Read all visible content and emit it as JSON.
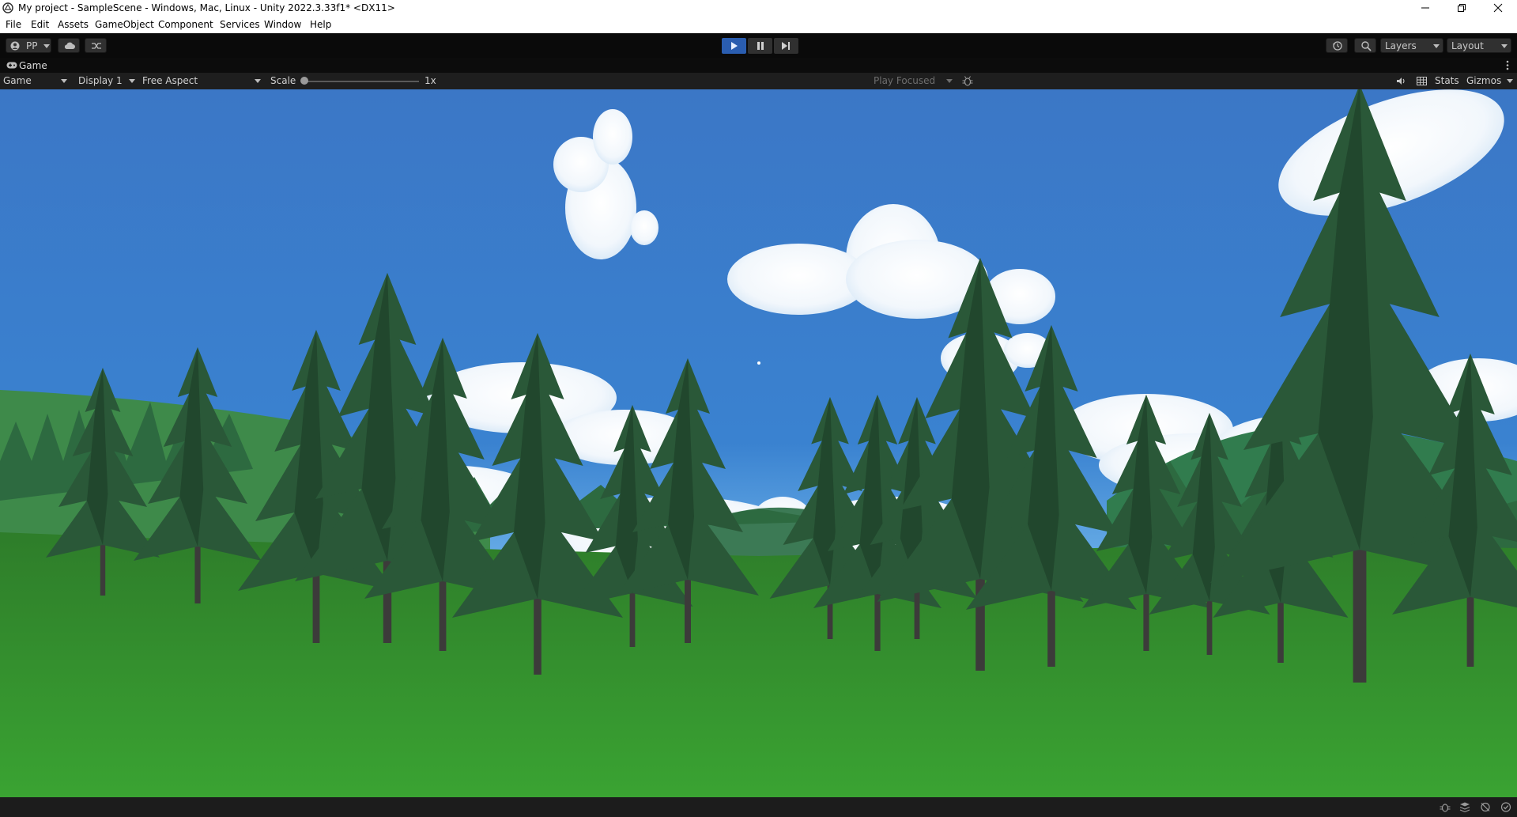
{
  "window": {
    "title": "My project - SampleScene - Windows, Mac, Linux - Unity 2022.3.33f1* <DX11>",
    "minimize_icon": "minimize-icon",
    "maximize_icon": "restore-icon",
    "close_icon": "close-icon"
  },
  "menu": {
    "items": [
      "File",
      "Edit",
      "Assets",
      "GameObject",
      "Component",
      "Services",
      "Window",
      "Help"
    ]
  },
  "toolbar": {
    "account_label": "PP",
    "cloud_icon": "cloud-icon",
    "collab_icon": "branch-icon",
    "play_icon": "play-icon",
    "pause_icon": "pause-icon",
    "step_icon": "step-icon",
    "history_icon": "history-icon",
    "search_icon": "search-icon",
    "layers_label": "Layers",
    "layout_label": "Layout",
    "play_state": "playing",
    "play_accent": "#2a5db0"
  },
  "tab": {
    "label": "Game",
    "icon": "gamepad-icon"
  },
  "game_toolbar": {
    "view_select": "Game",
    "display_select": "Display 1",
    "aspect_select": "Free Aspect",
    "scale_label": "Scale",
    "scale_value": "1x",
    "scale_slider_level": 0,
    "play_focused": "Play Focused",
    "bug_icon": "bug-icon",
    "audio_icon": "speaker-icon",
    "grid_icon": "grid-icon",
    "stats_label": "Stats",
    "gizmos_label": "Gizmos"
  },
  "status_bar": {
    "icons": [
      "bug-icon",
      "stack-icon",
      "no-sync-icon",
      "check-circle-icon"
    ]
  },
  "colors": {
    "sky": "#3a78c8",
    "grass": "#2f8a2a",
    "pine": "#2b5b3a"
  }
}
